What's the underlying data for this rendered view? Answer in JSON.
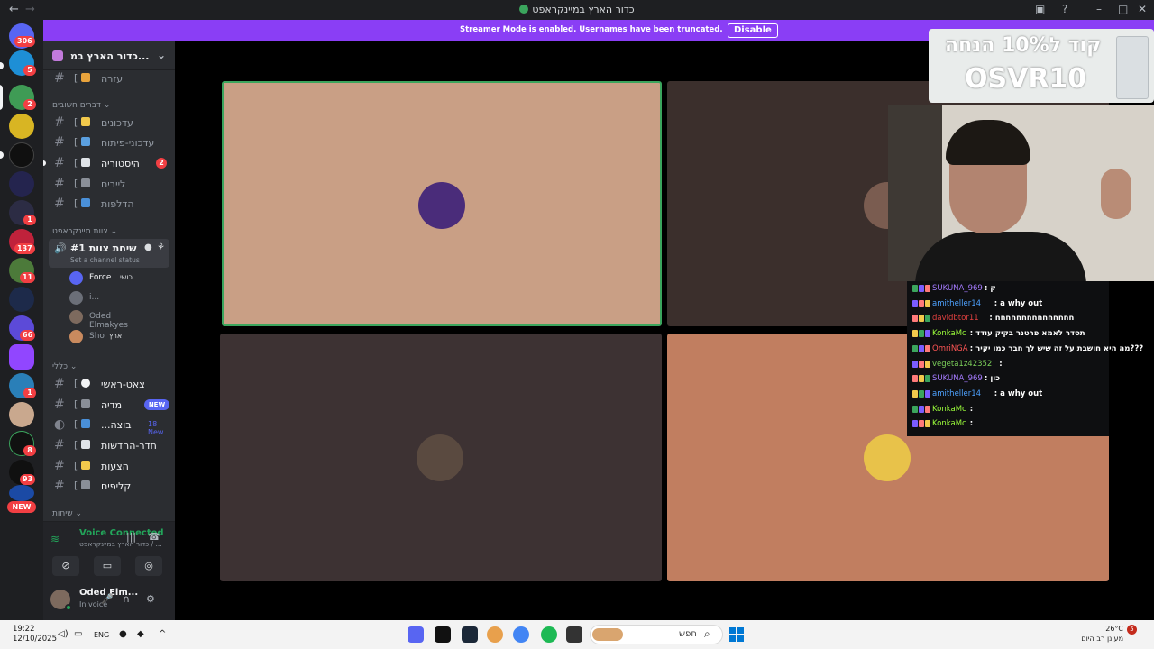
{
  "window": {
    "title": "כדור הארץ במיינקראפט"
  },
  "banner": {
    "message": "Streamer Mode is enabled. Usernames have been truncated.",
    "disable": "Disable"
  },
  "servers": {
    "badges": [
      "306",
      "5",
      "2",
      "1",
      "137",
      "11",
      "66",
      "1",
      "8",
      "93"
    ],
    "new_label": "NEW"
  },
  "sidebar": {
    "server_name": "כדור הארץ במ...",
    "help_channel": "עזרה",
    "cat_important": "דברים חשובים",
    "ch_updates": "עדכונים",
    "ch_devupdates": "עדכוני-פיתוח",
    "ch_history": "היסטוריה",
    "ch_history_badge": "2",
    "ch_lives": "לייבים",
    "ch_leaks": "הדלפות",
    "cat_teams": "צוות מיינקראפט",
    "vc_name": "שיחת צוות #1",
    "vc_status": "Set a channel status",
    "vc_users": [
      {
        "name": "Force",
        "tag": "כושי"
      },
      {
        "name": "i..."
      },
      {
        "name": "Oded Elmakyes"
      },
      {
        "name": "Sho",
        "tag": "ארץ"
      }
    ],
    "cat_general": "כללי",
    "ch_main": "צאט-ראשי",
    "ch_media": "מדיה",
    "ch_media_badge": "NEW",
    "ch_group": "...בוצה",
    "ch_group_new": "18 New",
    "ch_news": "חדר-החדשות",
    "ch_suggest": "הצעות",
    "ch_clips": "קליפים",
    "cat_calls": "שיחות"
  },
  "voice_panel": {
    "connected": "Voice Connected",
    "sub": "כדור הארץ במיינקראפט / ..."
  },
  "user": {
    "name": "Oded Elm...",
    "status": "In voice"
  },
  "ad": {
    "line1": "קוד ל10% הנחה",
    "line2": "OSVR10"
  },
  "chat": [
    {
      "user": "SUKUNA_969",
      "text": ": ק",
      "color": "#a57bff"
    },
    {
      "user": "amitheller14",
      "text": ": a why out",
      "color": "#4ea2ff"
    },
    {
      "user": "davidbtor11",
      "text": ": חחחחחחחחחחחחחחח",
      "color": "#e04040"
    },
    {
      "user": "KonkaMc",
      "text": ": תסדר לאמא פרטנר בקיק עודד",
      "color": "#9cff3b"
    },
    {
      "user": "OmriNGA",
      "text": ": מה היא חושבת על זה שיש לך חבר כמו יקיר???",
      "color": "#ff5555"
    },
    {
      "user": "vegeta1z42352",
      "text": ":",
      "color": "#7cd05a"
    },
    {
      "user": "SUKUNA_969",
      "text": ": כון",
      "color": "#a57bff"
    },
    {
      "user": "amitheller14",
      "text": ": a why out",
      "color": "#4ea2ff"
    },
    {
      "user": "KonkaMc",
      "text": ":",
      "color": "#9cff3b"
    },
    {
      "user": "KonkaMc",
      "text": ":",
      "color": "#9cff3b"
    }
  ],
  "taskbar": {
    "time": "19:22",
    "date": "12/10/2025",
    "lang": "ENG",
    "search": "חפש",
    "temp": "26°C",
    "weather": "מעונן רב היום",
    "notif": "5"
  }
}
